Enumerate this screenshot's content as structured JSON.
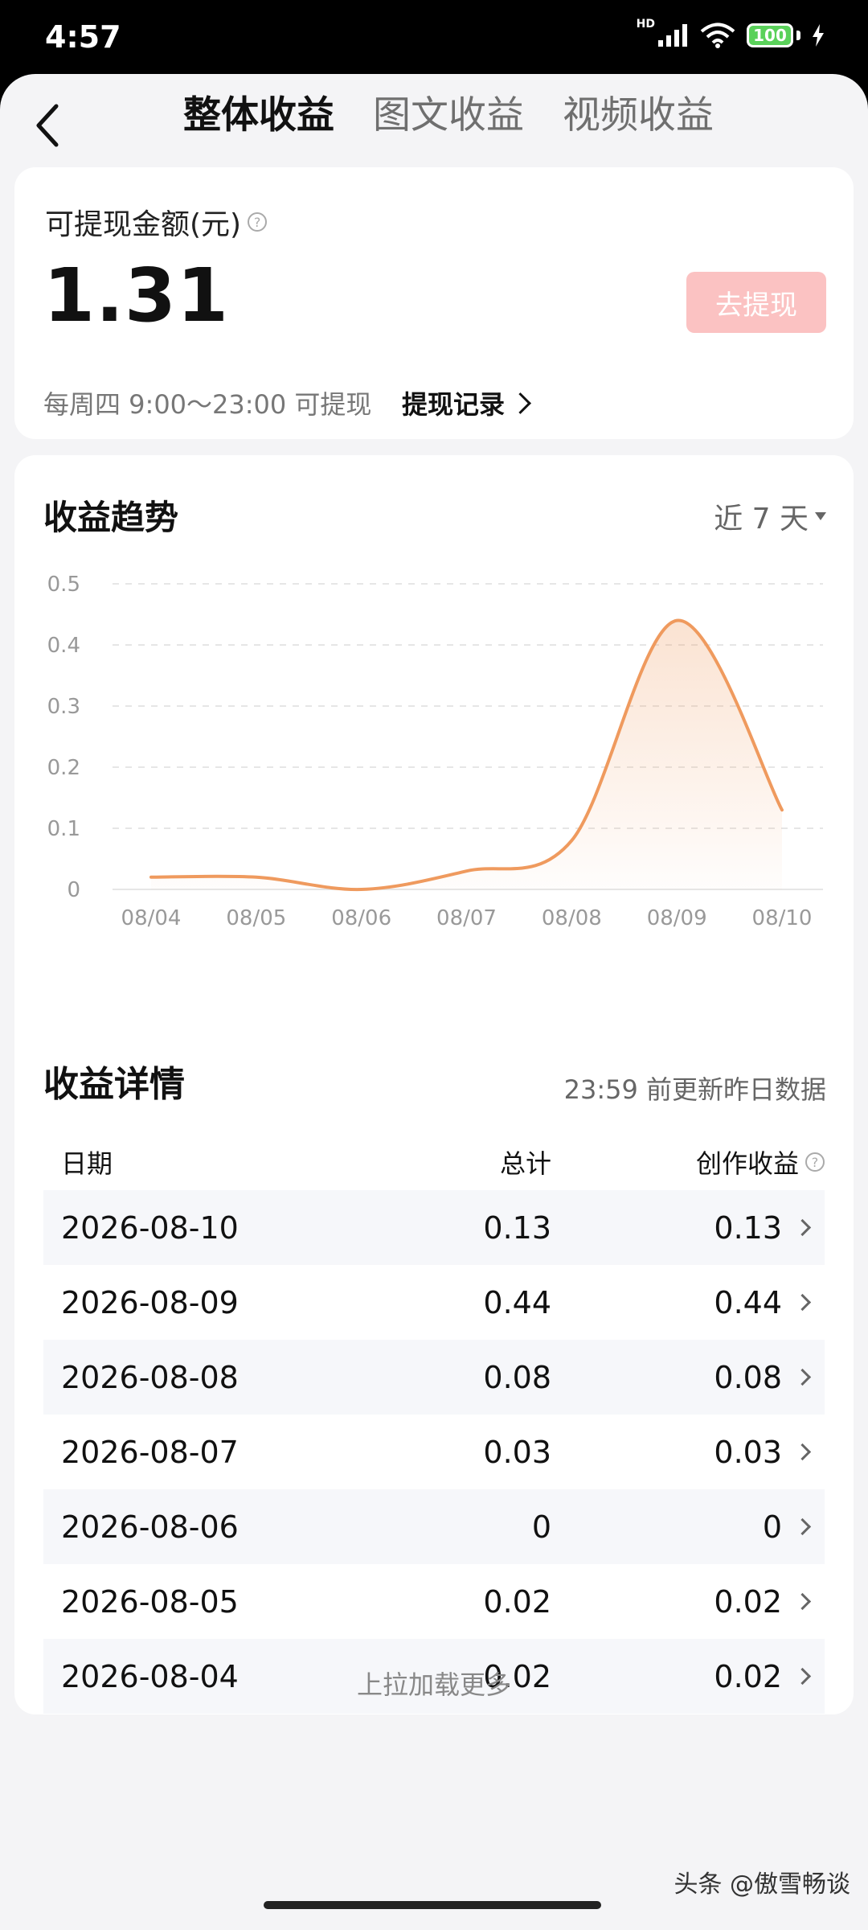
{
  "status": {
    "time": "4:57",
    "hd": "HD",
    "battery": "100"
  },
  "tabs": [
    {
      "label": "整体收益",
      "active": true
    },
    {
      "label": "图文收益",
      "active": false
    },
    {
      "label": "视频收益",
      "active": false
    }
  ],
  "withdraw": {
    "label": "可提现金额(元)",
    "help": "?",
    "amount": "1.31",
    "button": "去提现",
    "info": "每周四 9:00～23:00 可提现",
    "records": "提现记录"
  },
  "trend": {
    "title": "收益趋势",
    "range": "近 7 天"
  },
  "chart_data": {
    "type": "line",
    "x": [
      "08/04",
      "08/05",
      "08/06",
      "08/07",
      "08/08",
      "08/09",
      "08/10"
    ],
    "series": [
      {
        "values": [
          0.02,
          0.02,
          0,
          0.03,
          0.08,
          0.44,
          0.13
        ]
      }
    ],
    "yticks": [
      "0",
      "0.1",
      "0.2",
      "0.3",
      "0.4",
      "0.5"
    ],
    "ylim": [
      0,
      0.5
    ],
    "grid": true,
    "line_color": "#ef9a5e"
  },
  "details": {
    "title": "收益详情",
    "note": "23:59 前更新昨日数据",
    "headers": {
      "date": "日期",
      "total": "总计",
      "create": "创作收益"
    },
    "rows": [
      {
        "date": "2026-08-10",
        "total": "0.13",
        "create": "0.13"
      },
      {
        "date": "2026-08-09",
        "total": "0.44",
        "create": "0.44"
      },
      {
        "date": "2026-08-08",
        "total": "0.08",
        "create": "0.08"
      },
      {
        "date": "2026-08-07",
        "total": "0.03",
        "create": "0.03"
      },
      {
        "date": "2026-08-06",
        "total": "0",
        "create": "0"
      },
      {
        "date": "2026-08-05",
        "total": "0.02",
        "create": "0.02"
      },
      {
        "date": "2026-08-04",
        "total": "0.02",
        "create": "0.02"
      }
    ],
    "load_more": "上拉加载更多"
  },
  "watermark": "头条 @傲雪畅谈"
}
